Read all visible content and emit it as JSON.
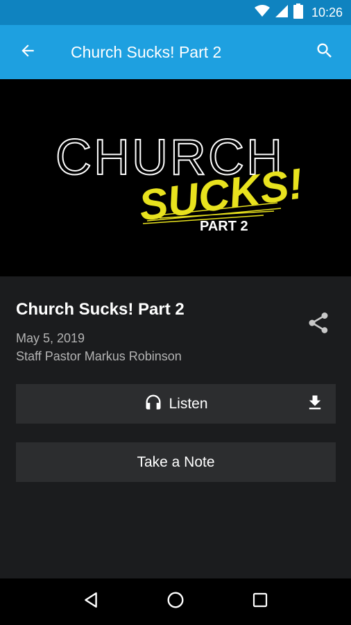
{
  "status_bar": {
    "time": "10:26",
    "icons": [
      "wifi-icon",
      "cell-signal-icon",
      "battery-icon"
    ]
  },
  "app_bar": {
    "title": "Church Sucks! Part 2",
    "back_icon": "arrow-left-icon",
    "search_icon": "search-icon",
    "color": "#1ea0e0"
  },
  "hero": {
    "line1": "CHURCH",
    "line2": "SUCKS!",
    "line3": "PART 2",
    "accent_color": "#e8e21e"
  },
  "sermon": {
    "title": "Church Sucks! Part 2",
    "date": "May 5, 2019",
    "speaker": "Staff Pastor Markus Robinson",
    "share_icon": "share-icon"
  },
  "actions": {
    "listen_label": "Listen",
    "listen_icon": "headphones-icon",
    "download_icon": "download-icon",
    "note_label": "Take a Note"
  },
  "nav_bar": {
    "icons": [
      "back-triangle-icon",
      "home-circle-icon",
      "recents-square-icon"
    ]
  }
}
